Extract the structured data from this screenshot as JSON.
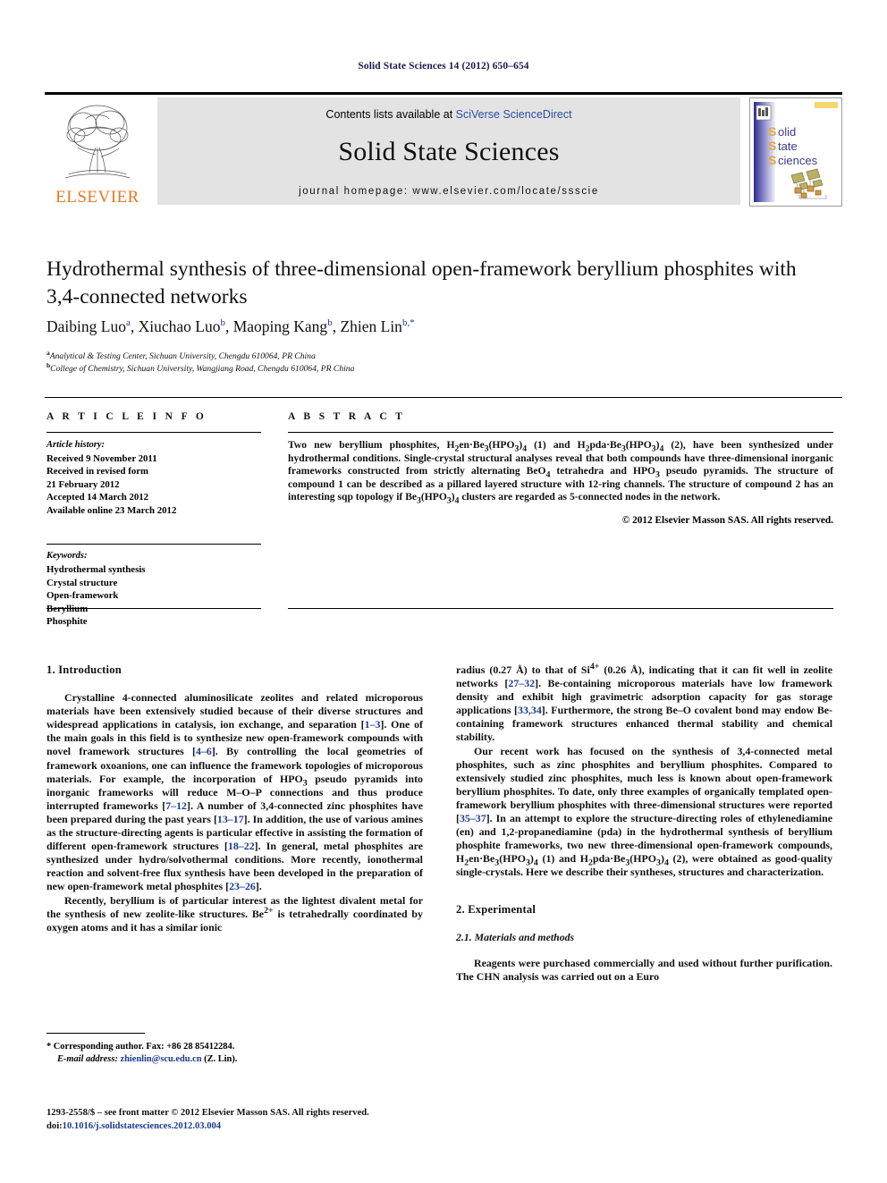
{
  "running_head": "Solid State Sciences 14 (2012) 650–654",
  "masthead": {
    "publisher_name": "ELSEVIER",
    "publisher_logo_icon": "elsevier-tree-icon",
    "contents_prefix": "Contents lists available at ",
    "contents_link": "SciVerse ScienceDirect",
    "journal_name": "Solid State Sciences",
    "homepage": "journal homepage: www.elsevier.com/locate/ssscie",
    "cover": {
      "line1": "Solid",
      "line2": "State",
      "line3": "Sciences"
    }
  },
  "article": {
    "title": "Hydrothermal synthesis of three-dimensional open-framework beryllium phosphites with 3,4-connected networks",
    "authors": [
      {
        "name": "Daibing Luo",
        "marks": "a"
      },
      {
        "name": "Xiuchao Luo",
        "marks": "b"
      },
      {
        "name": "Maoping Kang",
        "marks": "b"
      },
      {
        "name": "Zhien Lin",
        "marks": "b,*"
      }
    ],
    "affiliations": [
      {
        "mark": "a",
        "text": "Analytical & Testing Center, Sichuan University, Chengdu 610064, PR China"
      },
      {
        "mark": "b",
        "text": "College of Chemistry, Sichuan University, Wangjiang Road, Chengdu 610064, PR China"
      }
    ]
  },
  "info": {
    "heading": "A R T I C L E   I N F O",
    "history_label": "Article history:",
    "history": [
      "Received 9 November 2011",
      "Received in revised form",
      "21 February 2012",
      "Accepted 14 March 2012",
      "Available online 23 March 2012"
    ],
    "keywords_label": "Keywords:",
    "keywords": [
      "Hydrothermal synthesis",
      "Crystal structure",
      "Open-framework",
      "Beryllium",
      "Phosphite"
    ]
  },
  "abstract": {
    "heading": "A B S T R A C T",
    "copyright": "© 2012 Elsevier Masson SAS. All rights reserved."
  },
  "sections": {
    "intro_heading": "1.  Introduction",
    "experimental_heading": "2.  Experimental",
    "materials_heading": "2.1.  Materials and methods"
  },
  "footnote": {
    "corresponding": "* Corresponding author. Fax: +86 28 85412284.",
    "email_label": "E-mail address:",
    "email": "zhienlin@scu.edu.cn",
    "email_suffix": "(Z. Lin)."
  },
  "page_footer": {
    "line1": "1293-2558/$ – see front matter © 2012 Elsevier Masson SAS. All rights reserved.",
    "doi_prefix": "doi:",
    "doi": "10.1016/j.solidstatesciences.2012.03.004"
  },
  "colors": {
    "elsevier_orange": "#E87722",
    "link_blue": "#1a3a8f",
    "masthead_grey": "#e3e3e3"
  }
}
